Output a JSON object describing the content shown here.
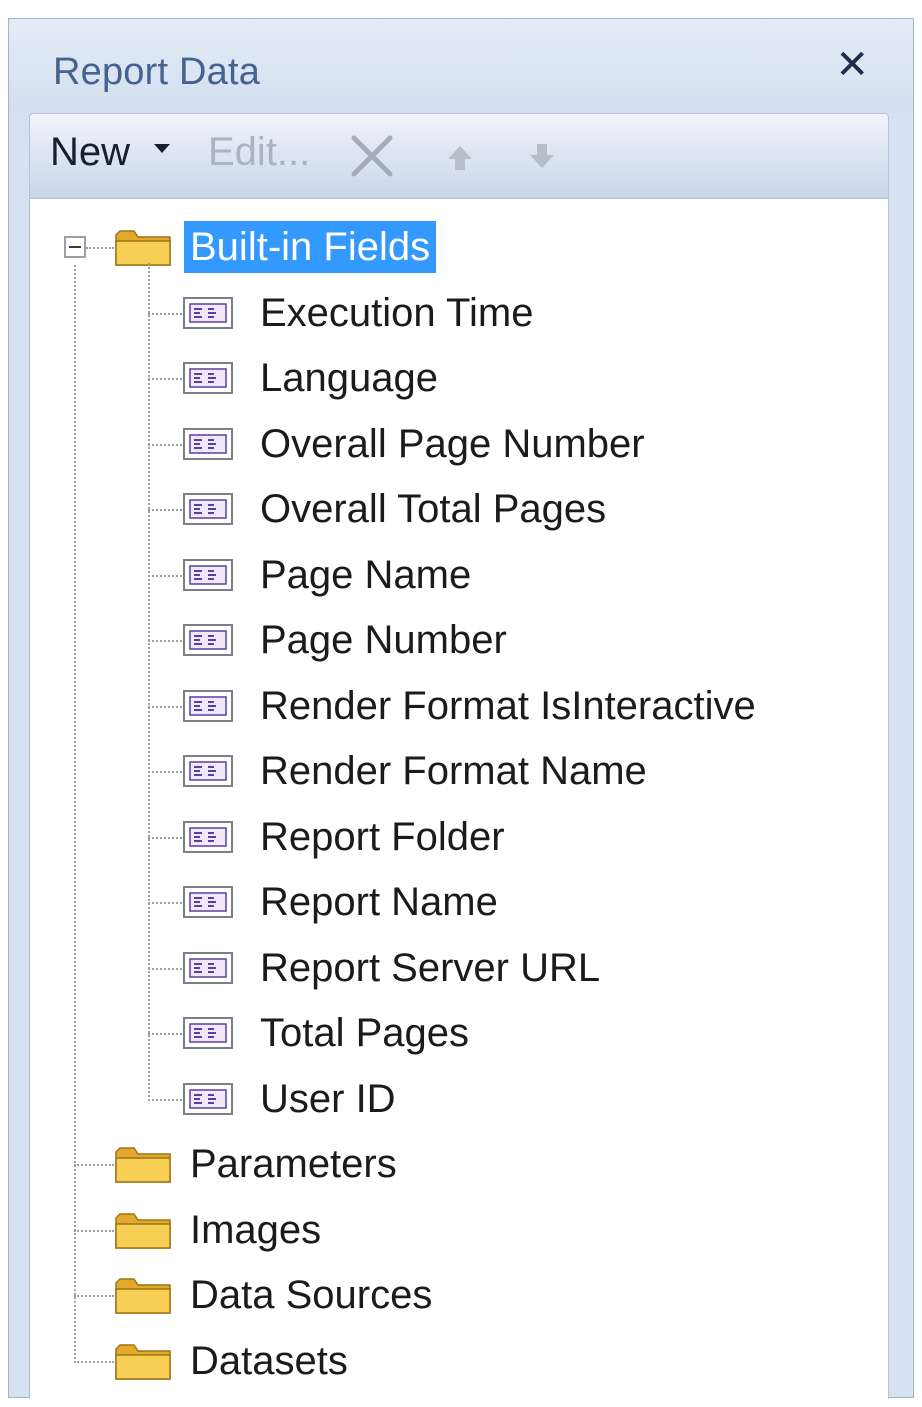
{
  "panel": {
    "title": "Report Data",
    "close_glyph": "✕"
  },
  "toolbar": {
    "new_label": "New",
    "edit_label": "Edit...",
    "delete_icon": "delete-x-icon",
    "move_up_icon": "move-up-icon",
    "move_down_icon": "move-down-icon"
  },
  "tree": {
    "built_in": {
      "label": "Built-in Fields",
      "expanded": true,
      "selected": true,
      "fields": [
        "Execution Time",
        "Language",
        "Overall Page Number",
        "Overall Total Pages",
        "Page Name",
        "Page Number",
        "Render Format IsInteractive",
        "Render Format Name",
        "Report Folder",
        "Report Name",
        "Report Server URL",
        "Total Pages",
        "User ID"
      ]
    },
    "folders": [
      "Parameters",
      "Images",
      "Data Sources",
      "Datasets"
    ]
  },
  "colors": {
    "selection": "#3399ff",
    "folder": "#f5c342",
    "field_icon": "#5a3fa0",
    "title_text": "#46628f"
  }
}
